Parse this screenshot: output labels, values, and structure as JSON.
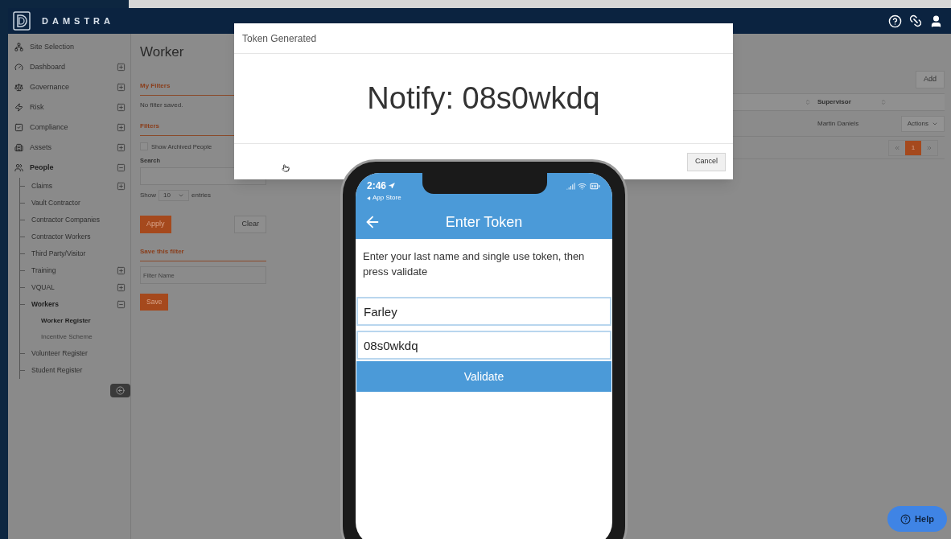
{
  "header": {
    "brand": "DAMSTRA"
  },
  "sidebar": {
    "items": [
      {
        "label": "Site Selection",
        "expandable": false,
        "expanded": false
      },
      {
        "label": "Dashboard",
        "expandable": true,
        "expanded": false
      },
      {
        "label": "Governance",
        "expandable": true,
        "expanded": false
      },
      {
        "label": "Risk",
        "expandable": true,
        "expanded": false
      },
      {
        "label": "Compliance",
        "expandable": true,
        "expanded": false
      },
      {
        "label": "Assets",
        "expandable": true,
        "expanded": false
      },
      {
        "label": "People",
        "expandable": true,
        "expanded": true,
        "children": [
          {
            "label": "Claims",
            "expandable": true,
            "expanded": false
          },
          {
            "label": "Vault Contractor",
            "expandable": false,
            "expanded": false
          },
          {
            "label": "Contractor Companies",
            "expandable": false,
            "expanded": false
          },
          {
            "label": "Contractor Workers",
            "expandable": false,
            "expanded": false
          },
          {
            "label": "Third Party/Visitor",
            "expandable": false,
            "expanded": false
          },
          {
            "label": "Training",
            "expandable": true,
            "expanded": false
          },
          {
            "label": "VQUAL",
            "expandable": true,
            "expanded": false
          },
          {
            "label": "Workers",
            "expandable": true,
            "expanded": true,
            "children": [
              {
                "label": "Worker Register",
                "selected": true
              },
              {
                "label": "Incentive Scheme",
                "selected": false
              }
            ]
          },
          {
            "label": "Volunteer Register",
            "expandable": false,
            "expanded": false
          },
          {
            "label": "Student Register",
            "expandable": false,
            "expanded": false
          }
        ]
      }
    ]
  },
  "page": {
    "title": "Worker",
    "my_filters": {
      "heading": "My Filters",
      "empty_text": "No filter saved."
    },
    "filters": {
      "heading": "Filters",
      "show_archived": {
        "label": "Show Archived People",
        "checked": false
      },
      "search_label": "Search",
      "show_prefix": "Show",
      "page_size": "10",
      "show_suffix": "entries",
      "apply": "Apply",
      "clear": "Clear"
    },
    "save_filter": {
      "heading": "Save this filter",
      "placeholder": "Filter Name",
      "save": "Save"
    }
  },
  "table": {
    "add": "Add",
    "columns": [
      "Supervisor"
    ],
    "rows": [
      {
        "supervisor": "Martin Daniels",
        "actions": "Actions"
      }
    ],
    "pages": [
      {
        "label": "1",
        "selected": true
      }
    ]
  },
  "modal": {
    "title": "Token Generated",
    "message": "Notify: 08s0wkdq",
    "cancel": "Cancel"
  },
  "phone": {
    "time": "2:46",
    "back_label": "App Store",
    "title": "Enter Token",
    "instructions": "Enter your last name and single use token, then press validate",
    "fields": [
      {
        "value": "Farley"
      },
      {
        "value": "08s0wkdq"
      }
    ],
    "button": "Validate"
  },
  "help": "Help"
}
